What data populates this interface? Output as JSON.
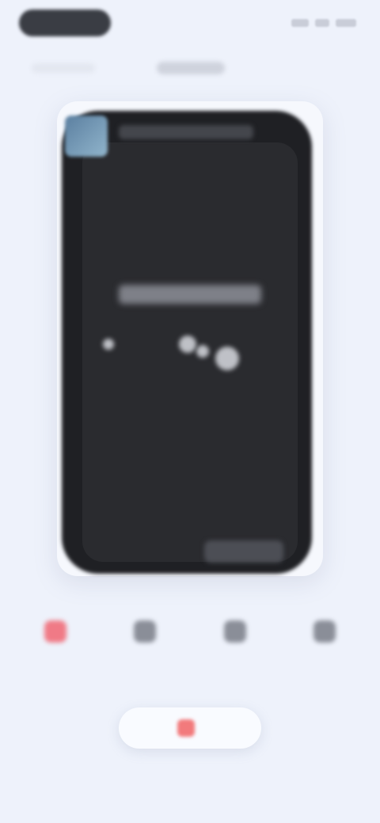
{
  "status_bar": {
    "time_label": ""
  },
  "header": {
    "title": "",
    "subtitle": ""
  },
  "preview": {
    "heading": "",
    "thumbnail_icon": "image-icon"
  },
  "tabs": [
    {
      "label": "",
      "icon": "heart-icon",
      "active": true
    },
    {
      "label": "",
      "icon": "circle-icon",
      "active": false
    },
    {
      "label": "",
      "icon": "circle-icon",
      "active": false
    },
    {
      "label": "",
      "icon": "circle-icon",
      "active": false
    }
  ],
  "action_button": {
    "label": "",
    "icon": "heart-icon"
  },
  "colors": {
    "accent": "#f07a86",
    "background": "#eef2fb",
    "phone": "#1f2024"
  }
}
